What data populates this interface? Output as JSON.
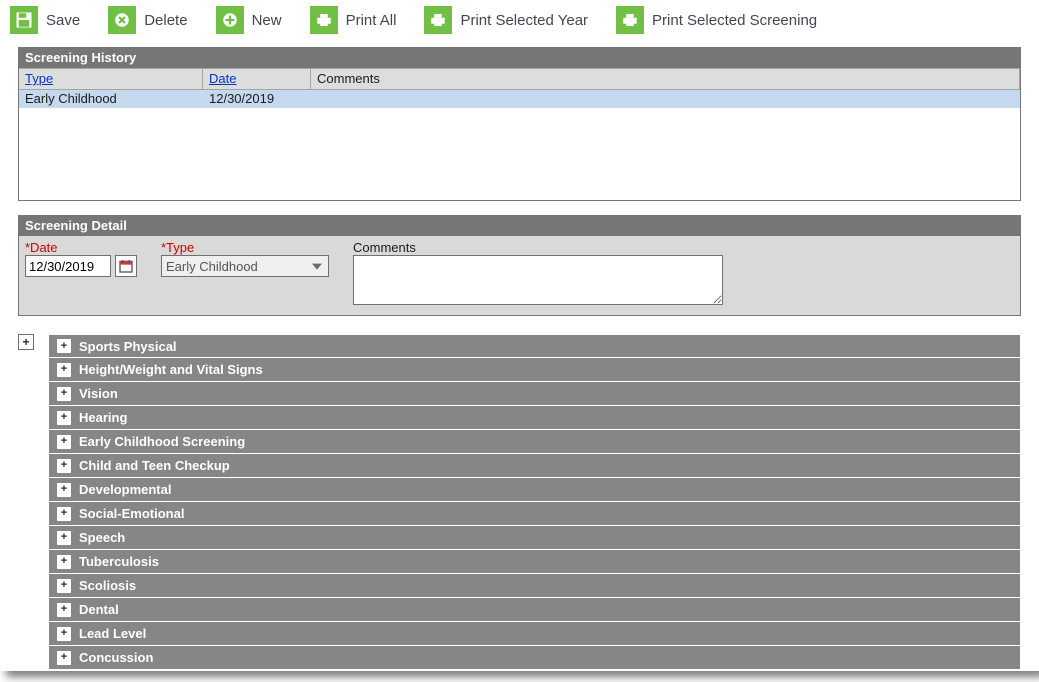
{
  "toolbar": {
    "save": "Save",
    "delete": "Delete",
    "new": "New",
    "print_all": "Print All",
    "print_year": "Print Selected Year",
    "print_screening": "Print Selected Screening"
  },
  "history": {
    "title": "Screening History",
    "headers": {
      "type": "Type",
      "date": "Date",
      "comments": "Comments"
    },
    "rows": [
      {
        "type": "Early Childhood",
        "date": "12/30/2019",
        "comments": ""
      }
    ]
  },
  "detail": {
    "title": "Screening Detail",
    "labels": {
      "date": "*Date",
      "type": "*Type",
      "comments": "Comments"
    },
    "date": "12/30/2019",
    "type": "Early Childhood",
    "comments": ""
  },
  "accordion": {
    "expand_all_glyph": "+",
    "plus_glyph": "+",
    "items": [
      "Sports Physical",
      "Height/Weight and Vital Signs",
      "Vision",
      "Hearing",
      "Early Childhood Screening",
      "Child and Teen Checkup",
      "Developmental",
      "Social-Emotional",
      "Speech",
      "Tuberculosis",
      "Scoliosis",
      "Dental",
      "Lead Level",
      "Concussion"
    ]
  }
}
